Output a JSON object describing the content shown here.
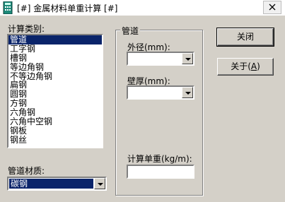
{
  "window": {
    "title": "[#] 金属材料单重计算 [#]",
    "close_glyph": "✕"
  },
  "category": {
    "label": "计算类别:",
    "items": [
      "管道",
      "工字钢",
      "槽钢",
      "等边角钢",
      "不等边角钢",
      "扁钢",
      "圆钢",
      "方钢",
      "六角钢",
      "六角中空钢",
      "钢板",
      "钢丝"
    ],
    "selected_index": 0
  },
  "material": {
    "label": "管道材质:",
    "value": "碳钢"
  },
  "group": {
    "title": "管道",
    "outer_diameter_label": "外径(mm):",
    "outer_diameter_value": "",
    "wall_thickness_label": "壁厚(mm):",
    "wall_thickness_value": "",
    "unit_weight_label": "计算单重(kg/m):",
    "unit_weight_value": ""
  },
  "buttons": {
    "close_label": "关闭",
    "about_label_prefix": "关于(",
    "about_label_key": "A",
    "about_label_suffix": ")"
  },
  "colors": {
    "selection": "#0a246a",
    "dialog_face": "#d4d0c8"
  }
}
